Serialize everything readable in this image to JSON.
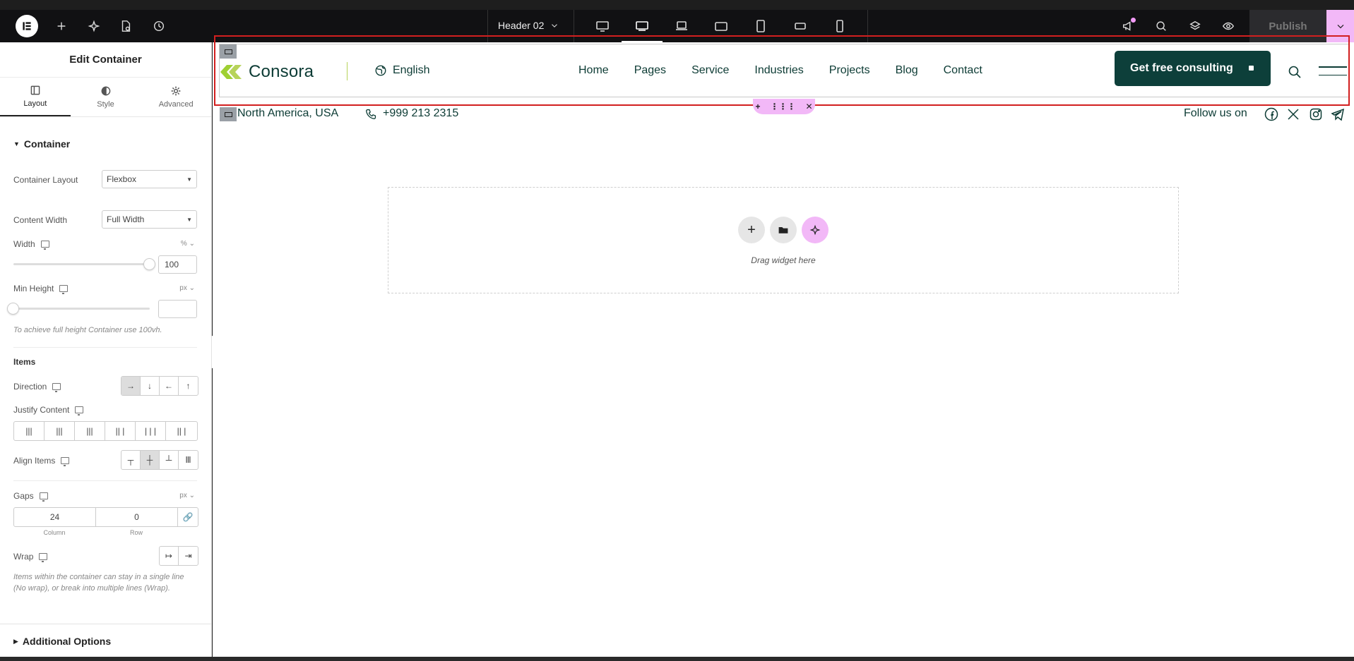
{
  "topbar": {
    "document_name": "Header 02",
    "publish_label": "Publish"
  },
  "panel": {
    "title": "Edit Container",
    "tabs": [
      {
        "label": "Layout",
        "icon": "layout-icon"
      },
      {
        "label": "Style",
        "icon": "style-icon"
      },
      {
        "label": "Advanced",
        "icon": "gear-icon"
      }
    ],
    "section_title": "Container",
    "container_layout": {
      "label": "Container Layout",
      "value": "Flexbox"
    },
    "content_width": {
      "label": "Content Width",
      "value": "Full Width"
    },
    "width": {
      "label": "Width",
      "unit": "%",
      "value": "100",
      "slider_fraction": 1.0
    },
    "min_height": {
      "label": "Min Height",
      "unit": "px",
      "value": "",
      "slider_fraction": 0.0
    },
    "min_height_hint": "To achieve full height Container use 100vh.",
    "items_title": "Items",
    "direction": {
      "label": "Direction",
      "selected": "row"
    },
    "justify_content": {
      "label": "Justify Content"
    },
    "align_items": {
      "label": "Align Items",
      "selected": "center"
    },
    "gaps": {
      "label": "Gaps",
      "unit": "px",
      "column_value": "24",
      "row_value": "0",
      "column_label": "Column",
      "row_label": "Row"
    },
    "wrap": {
      "label": "Wrap"
    },
    "wrap_hint": "Items within the container can stay in a single line (No wrap), or break into multiple lines (Wrap).",
    "additional_options": "Additional Options"
  },
  "canvas": {
    "logo_text": "Consora",
    "language": "English",
    "nav": [
      "Home",
      "Pages",
      "Service",
      "Industries",
      "Projects",
      "Blog",
      "Contact"
    ],
    "cta_label": "Get free consulting",
    "location": "North America, USA",
    "phone": "+999 213 2315",
    "follow_label": "Follow us on",
    "socials": [
      "facebook-icon",
      "x-icon",
      "instagram-icon",
      "telegram-icon"
    ],
    "drop_text": "Drag widget here"
  },
  "colors": {
    "brand_dark": "#0d3f3a",
    "brand_lime": "#9fd033",
    "selection_red": "#d21f1f",
    "accent_pink": "#f2b8f7"
  }
}
